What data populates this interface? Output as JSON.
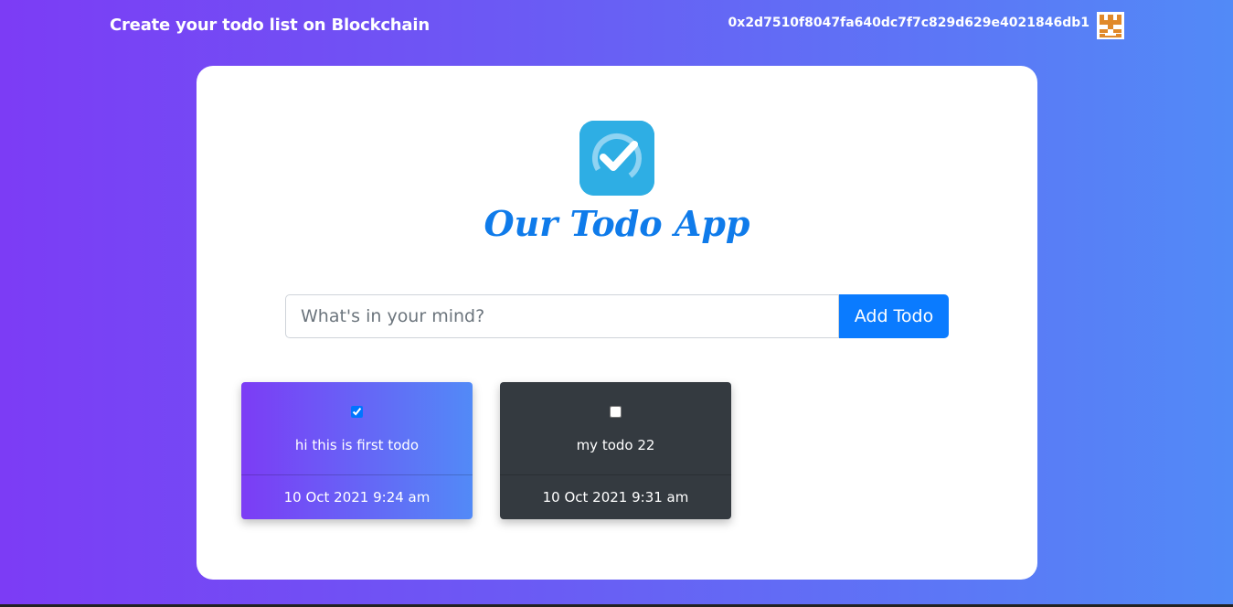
{
  "navbar": {
    "brand": "Create your todo list on Blockchain",
    "account": "0x2d7510f8047fa640dc7f7c829d629e4021846db1",
    "avatar_icon": "identicon-avatar"
  },
  "app": {
    "logo_icon": "checkmark-circle-icon",
    "title": "Our Todo App"
  },
  "form": {
    "placeholder": "What's in your mind?",
    "value": "",
    "add_label": "Add Todo"
  },
  "todos": [
    {
      "text": "hi this is first todo",
      "date": "10 Oct 2021 9:24 am",
      "completed": true
    },
    {
      "text": "my todo 22",
      "date": "10 Oct 2021 9:31 am",
      "completed": false
    }
  ],
  "colors": {
    "gradient_start": "#7c3cf5",
    "gradient_end": "#528af7",
    "accent": "#0a7bff",
    "title": "#0f7bea",
    "dark_card": "#343a40"
  }
}
